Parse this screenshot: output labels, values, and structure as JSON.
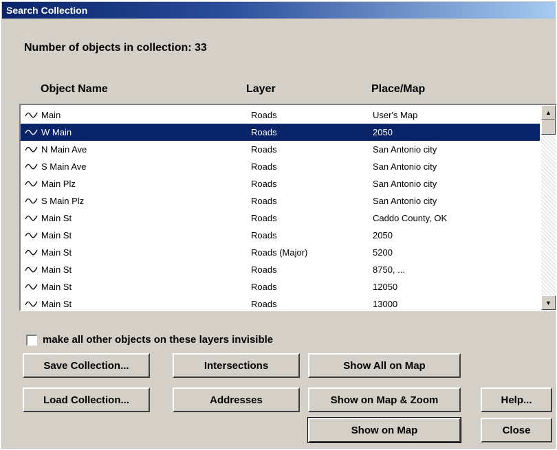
{
  "window": {
    "title": "Search Collection"
  },
  "collection": {
    "count_label": "Number of objects in collection:  33"
  },
  "columns": [
    "Object Name",
    "Layer",
    "Place/Map"
  ],
  "rows": [
    {
      "icon": "line-icon",
      "name": "Main",
      "layer": "Roads",
      "place": "User's Map",
      "selected": false
    },
    {
      "icon": "line-icon",
      "name": "W Main",
      "layer": "Roads",
      "place": "2050",
      "selected": true
    },
    {
      "icon": "line-icon",
      "name": "N Main Ave",
      "layer": "Roads",
      "place": "San Antonio city",
      "selected": false
    },
    {
      "icon": "line-icon",
      "name": "S Main Ave",
      "layer": "Roads",
      "place": "San Antonio city",
      "selected": false
    },
    {
      "icon": "line-icon",
      "name": "Main Plz",
      "layer": "Roads",
      "place": "San Antonio city",
      "selected": false
    },
    {
      "icon": "line-icon",
      "name": "S Main Plz",
      "layer": "Roads",
      "place": "San Antonio city",
      "selected": false
    },
    {
      "icon": "line-icon",
      "name": "Main St",
      "layer": "Roads",
      "place": "Caddo County, OK",
      "selected": false
    },
    {
      "icon": "line-icon",
      "name": "Main St",
      "layer": "Roads",
      "place": "2050",
      "selected": false
    },
    {
      "icon": "line-icon",
      "name": "Main St",
      "layer": "Roads (Major)",
      "place": "5200",
      "selected": false
    },
    {
      "icon": "line-icon",
      "name": "Main St",
      "layer": "Roads",
      "place": "8750, ...",
      "selected": false
    },
    {
      "icon": "line-icon",
      "name": "Main St",
      "layer": "Roads",
      "place": "12050",
      "selected": false
    },
    {
      "icon": "line-icon",
      "name": "Main St",
      "layer": "Roads",
      "place": "13000",
      "selected": false
    }
  ],
  "options": {
    "invisible_checkbox": {
      "label": "make all other objects on these layers invisible",
      "checked": false
    }
  },
  "buttons": {
    "save_collection": "Save Collection...",
    "intersections": "Intersections",
    "show_all_on_map": "Show All on Map",
    "load_collection": "Load Collection...",
    "addresses": "Addresses",
    "show_on_map_zoom": "Show on Map & Zoom",
    "help": "Help...",
    "show_on_map": "Show on Map",
    "close": "Close"
  },
  "colors": {
    "selection": "#0a246a",
    "dialog": "#d4d0c8"
  }
}
